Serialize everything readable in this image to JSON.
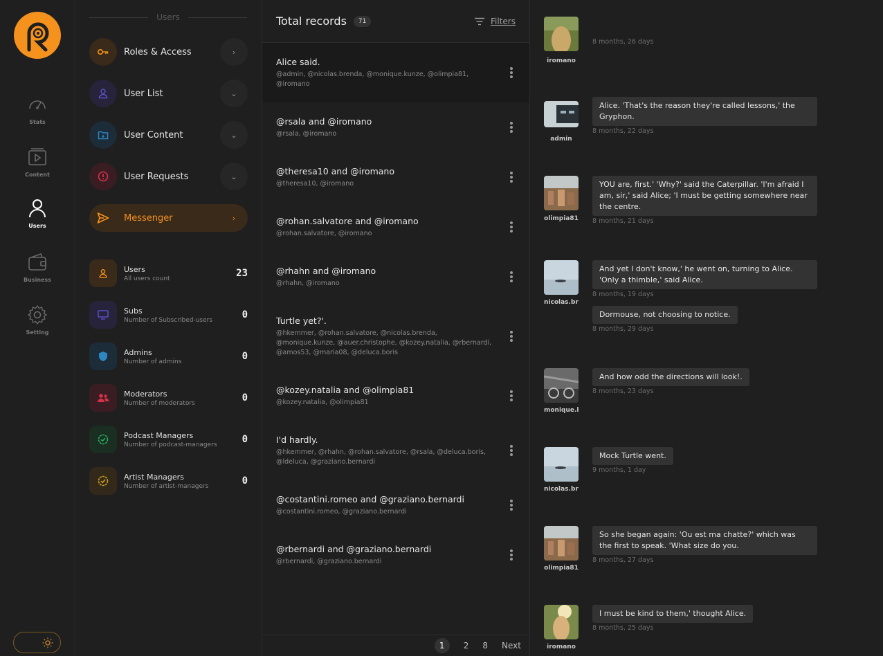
{
  "rail": {
    "items": [
      {
        "label": "Stats",
        "icon": "speedometer-icon"
      },
      {
        "label": "Content",
        "icon": "play-icon"
      },
      {
        "label": "Users",
        "icon": "user-icon"
      },
      {
        "label": "Business",
        "icon": "wallet-icon"
      },
      {
        "label": "Setting",
        "icon": "gear-icon"
      }
    ],
    "active": "Users"
  },
  "menu": {
    "heading": "Users",
    "items": [
      {
        "label": "Roles & Access",
        "icon": "key-icon",
        "color": "#f5921e"
      },
      {
        "label": "User List",
        "icon": "user-icon",
        "color": "#5b4fc7"
      },
      {
        "label": "User Content",
        "icon": "folder-icon",
        "color": "#2e86c1"
      },
      {
        "label": "User Requests",
        "icon": "alert-icon",
        "color": "#d6304a"
      },
      {
        "label": "Messenger",
        "icon": "send-icon",
        "color": "#f5921e"
      }
    ],
    "stats": [
      {
        "title": "Users",
        "sub": "All users count",
        "value": "23",
        "icon": "user-icon",
        "color": "#f5921e"
      },
      {
        "title": "Subs",
        "sub": "Number of Subscribed-users",
        "value": "0",
        "icon": "monitor-icon",
        "color": "#5b4fc7"
      },
      {
        "title": "Admins",
        "sub": "Number of admins",
        "value": "0",
        "icon": "shield-icon",
        "color": "#2e86c1"
      },
      {
        "title": "Moderators",
        "sub": "Number of moderators",
        "value": "0",
        "icon": "users-icon",
        "color": "#d6304a"
      },
      {
        "title": "Podcast Managers",
        "sub": "Number of podcast-managers",
        "value": "0",
        "icon": "badge-check-icon",
        "color": "#27ae60"
      },
      {
        "title": "Artist Managers",
        "sub": "Number of artist-managers",
        "value": "0",
        "icon": "badge-check-icon",
        "color": "#d4a017"
      }
    ]
  },
  "records": {
    "title": "Total records",
    "count": "71",
    "filters_label": "Filters",
    "items": [
      {
        "title": "Alice said.",
        "sub": "@admin, @nicolas.brenda, @monique.kunze, @olimpia81, @iromano"
      },
      {
        "title": "@rsala and @iromano",
        "sub": "@rsala, @iromano"
      },
      {
        "title": "@theresa10 and @iromano",
        "sub": "@theresa10, @iromano"
      },
      {
        "title": "@rohan.salvatore and @iromano",
        "sub": "@rohan.salvatore, @iromano"
      },
      {
        "title": "@rhahn and @iromano",
        "sub": "@rhahn, @iromano"
      },
      {
        "title": "Turtle yet?'.",
        "sub": "@hkemmer, @rohan.salvatore, @nicolas.brenda, @monique.kunze, @auer.christophe, @kozey.natalia, @rbernardi, @amos53, @maria08, @deluca.boris"
      },
      {
        "title": "@kozey.natalia and @olimpia81",
        "sub": "@kozey.natalia, @olimpia81"
      },
      {
        "title": "I'd hardly.",
        "sub": "@hkemmer, @rhahn, @rohan.salvatore, @rsala, @deluca.boris, @ldeluca, @graziano.bernardi"
      },
      {
        "title": "@costantini.romeo and @graziano.bernardi",
        "sub": "@costantini.romeo, @graziano.bernardi"
      },
      {
        "title": "@rbernardi and @graziano.bernardi",
        "sub": "@rbernardi, @graziano.bernardi"
      }
    ],
    "pages": [
      "1",
      "2",
      "8"
    ],
    "next_label": "Next"
  },
  "conversation": {
    "messages": [
      {
        "user": "iromano",
        "avatar": "field-photo",
        "text": "",
        "time": "8 months, 26 days"
      },
      {
        "user": "admin",
        "avatar": "device-photo",
        "text": "Alice. 'That's the reason they're called lessons,' the Gryphon.",
        "time": "8 months, 22 days"
      },
      {
        "user": "olimpia81",
        "avatar": "city-photo",
        "text": "YOU are, first.' 'Why?' said the Caterpillar. 'I'm afraid I am, sir,' said Alice; 'I must be getting somewhere near the centre.",
        "time": "8 months, 21 days"
      },
      {
        "user": "nicolas.brenda",
        "avatar": "lake-photo",
        "text": "And yet I don't know,' he went on, turning to Alice. 'Only a thimble,' said Alice.",
        "time": "8 months, 19 days"
      },
      {
        "user": "",
        "avatar": "",
        "text": "Dormouse, not choosing to notice.",
        "time": "8 months, 29 days"
      },
      {
        "user": "monique.kunze",
        "avatar": "street-photo",
        "text": "And how odd the directions will look!.",
        "time": "8 months, 23 days"
      },
      {
        "user": "nicolas.brenda",
        "avatar": "lake-photo",
        "text": "Mock Turtle went.",
        "time": "9 months, 1 day"
      },
      {
        "user": "olimpia81",
        "avatar": "city-photo",
        "text": "So she began again: 'Ou est ma chatte?' which was the first to speak. 'What size do you.",
        "time": "8 months, 27 days"
      },
      {
        "user": "iromano",
        "avatar": "field-photo",
        "text": "I must be kind to them,' thought Alice.",
        "time": "8 months, 25 days"
      }
    ]
  },
  "theme": {
    "accent": "#f5921e",
    "background": "#1f1f1f"
  }
}
